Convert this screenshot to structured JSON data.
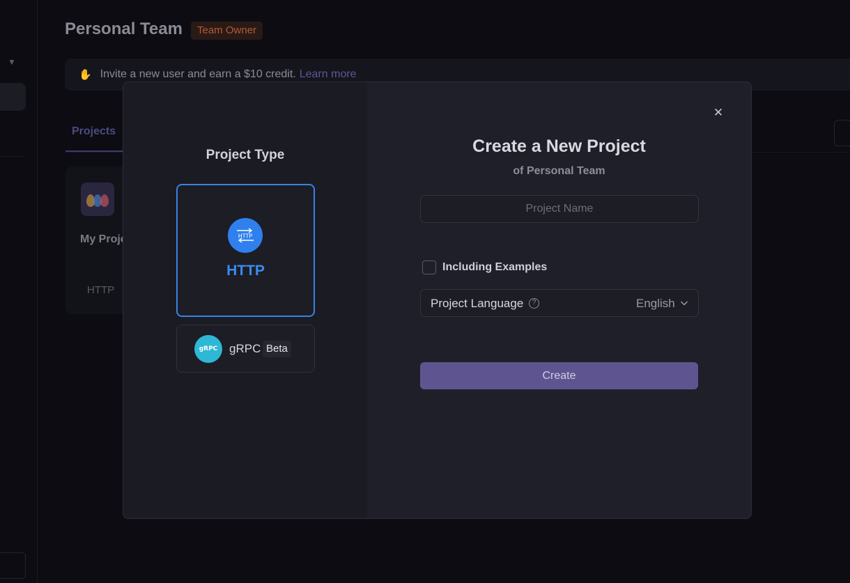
{
  "background": {
    "team_title": "Personal Team",
    "owner_badge": "Team Owner",
    "invite": {
      "text": "Invite a new user and earn a $10 credit.",
      "link": "Learn more",
      "icon": "wave-icon"
    },
    "tab_projects": "Projects",
    "project_card": {
      "name": "My Proje",
      "type": "HTTP"
    }
  },
  "modal": {
    "project_type_heading": "Project Type",
    "types": {
      "http": {
        "label": "HTTP",
        "icon_text": "HTTP",
        "selected": true
      },
      "grpc": {
        "label": "gRPC",
        "badge": "Beta",
        "icon_text": "gRPC"
      }
    },
    "title": "Create a New Project",
    "subtitle": "of Personal Team",
    "name_input": {
      "value": "",
      "placeholder": "Project Name"
    },
    "including_examples": {
      "label": "Including Examples",
      "checked": false
    },
    "language": {
      "label": "Project Language",
      "value": "English"
    },
    "create_label": "Create"
  },
  "colors": {
    "accent_blue": "#3b82e5",
    "grpc_teal": "#2fb7d6",
    "create_button": "#5e5590",
    "owner_badge_text": "#b45a36"
  }
}
